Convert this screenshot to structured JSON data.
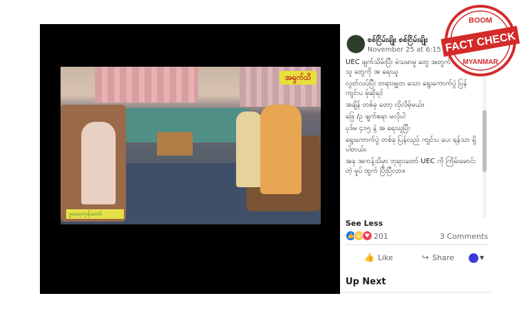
{
  "video": {
    "logo_text": "အရှက်သိ",
    "caption_text": "ဖူးမော့ကုန်းတော်"
  },
  "post": {
    "author": "စစ်ငြိမ်းချိုး စစ်ငြိမ်းချိုး",
    "date": "November 25 at 6:15 PM ·",
    "lines": [
      "UEC ဖျက်သိမ်းပြီး မဲသမာမှု တွေ အတွက် တာဝန်ရှိသူ တွေကို အ ရေးယူ",
      "လွတ်လပ်ပြီး တရားမျှတ သော ရွေးကောက်ပွဲ ပြန်ကျင်းပ မှ်ဆိုရင်",
      "အချိန် တစ်ခု တော့ လိုလိမ့်မယ်။",
      "ဖြေ /ဥ ဖျက်စရာ မလိုပါ",
      "ပုဒ်မ ၄၁၅ နဲ့ အ ရေးယူပြီး",
      "ရွေးကောက်ပွဲ တစ်ခု ပြန်လည် ကျင်းပ ပေး ရန်သာ ရှိပါတယ်။",
      "အခု အကန့်သိမှာ ဘုရားတော် UEC ကို ကြိမ်းမောင်းတဲ့ မှုပ် ထွက် ပြီးပြီလား။"
    ],
    "see_less": "See Less",
    "reaction_count": "201",
    "comments": "3 Comments",
    "like_label": "Like",
    "share_label": "Share",
    "up_next": "Up Next"
  },
  "stamp": {
    "top": "BOOM",
    "main": "FACT CHECK",
    "bottom": "MYANMAR"
  }
}
